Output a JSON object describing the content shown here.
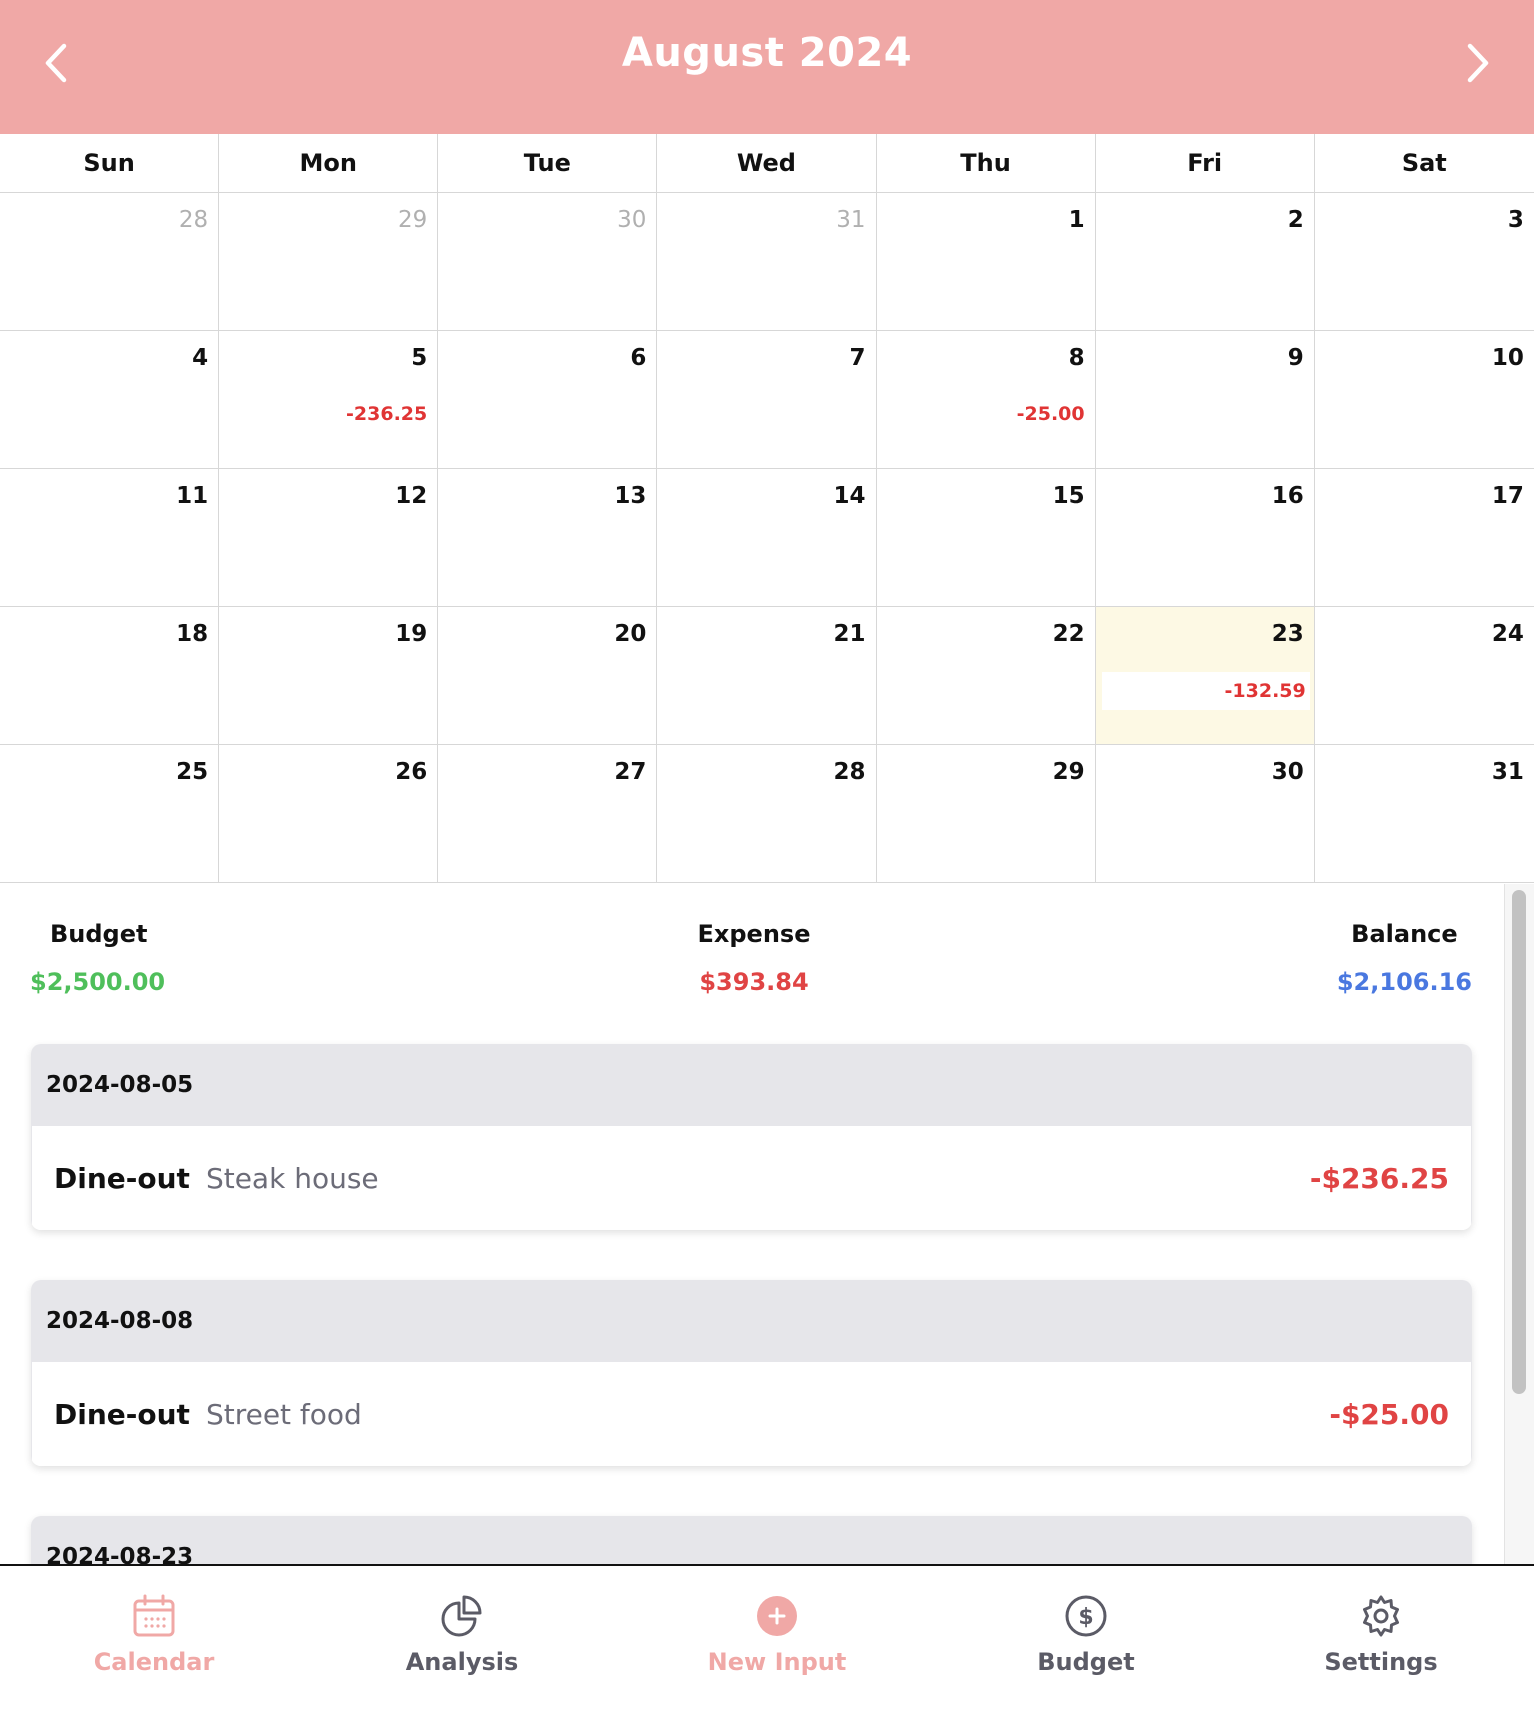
{
  "header": {
    "title": "August 2024"
  },
  "weekdays": [
    "Sun",
    "Mon",
    "Tue",
    "Wed",
    "Thu",
    "Fri",
    "Sat"
  ],
  "days": [
    {
      "num": "28",
      "other": true,
      "amount": ""
    },
    {
      "num": "29",
      "other": true,
      "amount": ""
    },
    {
      "num": "30",
      "other": true,
      "amount": ""
    },
    {
      "num": "31",
      "other": true,
      "amount": ""
    },
    {
      "num": "1",
      "other": false,
      "amount": ""
    },
    {
      "num": "2",
      "other": false,
      "amount": ""
    },
    {
      "num": "3",
      "other": false,
      "amount": ""
    },
    {
      "num": "4",
      "other": false,
      "amount": ""
    },
    {
      "num": "5",
      "other": false,
      "amount": "-236.25"
    },
    {
      "num": "6",
      "other": false,
      "amount": ""
    },
    {
      "num": "7",
      "other": false,
      "amount": ""
    },
    {
      "num": "8",
      "other": false,
      "amount": "-25.00"
    },
    {
      "num": "9",
      "other": false,
      "amount": ""
    },
    {
      "num": "10",
      "other": false,
      "amount": ""
    },
    {
      "num": "11",
      "other": false,
      "amount": ""
    },
    {
      "num": "12",
      "other": false,
      "amount": ""
    },
    {
      "num": "13",
      "other": false,
      "amount": ""
    },
    {
      "num": "14",
      "other": false,
      "amount": ""
    },
    {
      "num": "15",
      "other": false,
      "amount": ""
    },
    {
      "num": "16",
      "other": false,
      "amount": ""
    },
    {
      "num": "17",
      "other": false,
      "amount": ""
    },
    {
      "num": "18",
      "other": false,
      "amount": ""
    },
    {
      "num": "19",
      "other": false,
      "amount": ""
    },
    {
      "num": "20",
      "other": false,
      "amount": ""
    },
    {
      "num": "21",
      "other": false,
      "amount": ""
    },
    {
      "num": "22",
      "other": false,
      "amount": ""
    },
    {
      "num": "23",
      "other": false,
      "amount": "-132.59",
      "today": true
    },
    {
      "num": "24",
      "other": false,
      "amount": ""
    },
    {
      "num": "25",
      "other": false,
      "amount": ""
    },
    {
      "num": "26",
      "other": false,
      "amount": ""
    },
    {
      "num": "27",
      "other": false,
      "amount": ""
    },
    {
      "num": "28",
      "other": false,
      "amount": ""
    },
    {
      "num": "29",
      "other": false,
      "amount": ""
    },
    {
      "num": "30",
      "other": false,
      "amount": ""
    },
    {
      "num": "31",
      "other": false,
      "amount": ""
    }
  ],
  "summary": {
    "budget_label": "Budget",
    "budget_value": "$2,500.00",
    "expense_label": "Expense",
    "expense_value": "$393.84",
    "balance_label": "Balance",
    "balance_value": "$2,106.16"
  },
  "transactions": [
    {
      "date": "2024-08-05",
      "items": [
        {
          "category": "Dine-out",
          "description": "Steak house",
          "amount": "-$236.25"
        }
      ]
    },
    {
      "date": "2024-08-08",
      "items": [
        {
          "category": "Dine-out",
          "description": "Street food",
          "amount": "-$25.00"
        }
      ]
    },
    {
      "date": "2024-08-23",
      "items": []
    }
  ],
  "tabs": {
    "calendar": "Calendar",
    "analysis": "Analysis",
    "new_input": "New Input",
    "budget": "Budget",
    "settings": "Settings"
  },
  "colors": {
    "accent": "#f0a8a6",
    "expense": "#e04444",
    "budget": "#4fbf5b",
    "balance": "#4a78e0",
    "today_bg": "#fdf9e4"
  },
  "icons": {
    "prev": "chevron-left-icon",
    "next": "chevron-right-icon",
    "calendar": "calendar-icon",
    "analysis": "pie-chart-icon",
    "new_input": "plus-circle-icon",
    "budget": "dollar-circle-icon",
    "settings": "gear-icon"
  }
}
